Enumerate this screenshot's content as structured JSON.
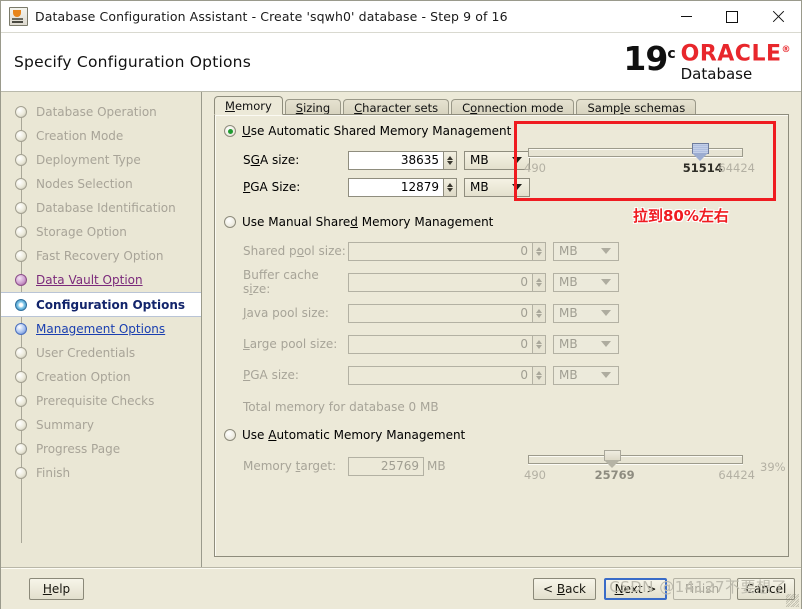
{
  "window": {
    "title": "Database Configuration Assistant - Create 'sqwh0' database - Step 9 of 16",
    "app_icon": "java-app-icon",
    "controls": {
      "minimize": "minimize-icon",
      "maximize": "maximize-icon",
      "close": "close-icon"
    }
  },
  "banner": {
    "title": "Specify Configuration Options",
    "brand": {
      "version": "19",
      "superscript": "c",
      "product": "ORACLE",
      "registered": "®",
      "subtitle": "Database"
    }
  },
  "sidebar": {
    "items": [
      {
        "label": "Database Operation",
        "state": "done"
      },
      {
        "label": "Creation Mode",
        "state": "done"
      },
      {
        "label": "Deployment Type",
        "state": "done"
      },
      {
        "label": "Nodes Selection",
        "state": "done"
      },
      {
        "label": "Database Identification",
        "state": "done"
      },
      {
        "label": "Storage Option",
        "state": "done"
      },
      {
        "label": "Fast Recovery Option",
        "state": "done"
      },
      {
        "label": "Data Vault Option",
        "state": "visited"
      },
      {
        "label": "Configuration Options",
        "state": "active"
      },
      {
        "label": "Management Options",
        "state": "link"
      },
      {
        "label": "User Credentials",
        "state": "done"
      },
      {
        "label": "Creation Option",
        "state": "done"
      },
      {
        "label": "Prerequisite Checks",
        "state": "done"
      },
      {
        "label": "Summary",
        "state": "done"
      },
      {
        "label": "Progress Page",
        "state": "done"
      },
      {
        "label": "Finish",
        "state": "done"
      }
    ]
  },
  "tabs": [
    {
      "label": "Memory",
      "mnemonic": "M",
      "selected": true
    },
    {
      "label": "Sizing",
      "mnemonic": "S",
      "selected": false
    },
    {
      "label": "Character sets",
      "mnemonic": "C",
      "selected": false
    },
    {
      "label": "Connection mode",
      "mnemonic": "o",
      "selected": false
    },
    {
      "label": "Sample schemas",
      "mnemonic": "l",
      "selected": false
    }
  ],
  "memory": {
    "asmm": {
      "label_pre": "Use ",
      "mnemonic": "U",
      "label_post": "se Automatic Shared Memory Management",
      "full_label": "Use Automatic Shared Memory Management",
      "selected": true,
      "sga": {
        "label": "SGA size:",
        "value": "38635",
        "unit": "MB"
      },
      "pga": {
        "label": "PGA Size:",
        "value": "12879",
        "unit": "MB"
      },
      "slider": {
        "min": "490",
        "current": "51514",
        "max": "64424",
        "percent": 80
      }
    },
    "manual": {
      "full_label": "Use Manual Shared Memory Management",
      "selected": false,
      "fields": [
        {
          "label": "Shared pool size:",
          "value": "0",
          "unit": "MB"
        },
        {
          "label": "Buffer cache size:",
          "value": "0",
          "unit": "MB"
        },
        {
          "label": "Java pool size:",
          "value": "0",
          "unit": "MB"
        },
        {
          "label": "Large pool size:",
          "value": "0",
          "unit": "MB"
        },
        {
          "label": "PGA size:",
          "value": "0",
          "unit": "MB"
        }
      ],
      "total": "Total memory for database 0 MB"
    },
    "amm": {
      "full_label": "Use Automatic Memory Management",
      "selected": false,
      "target": {
        "label": "Memory target:",
        "value": "25769",
        "unit": "MB"
      },
      "slider": {
        "min": "490",
        "current": "25769",
        "max": "64424",
        "percent_label": "39%",
        "percent": 39
      }
    }
  },
  "annotation": {
    "text": "拉到80%左右",
    "color": "#ef1b20"
  },
  "footer": {
    "help": "Help",
    "back": "< Back",
    "next": "Next >",
    "finish": "Finish",
    "cancel": "Cancel",
    "watermark": "CSDN @14127不要想了"
  }
}
